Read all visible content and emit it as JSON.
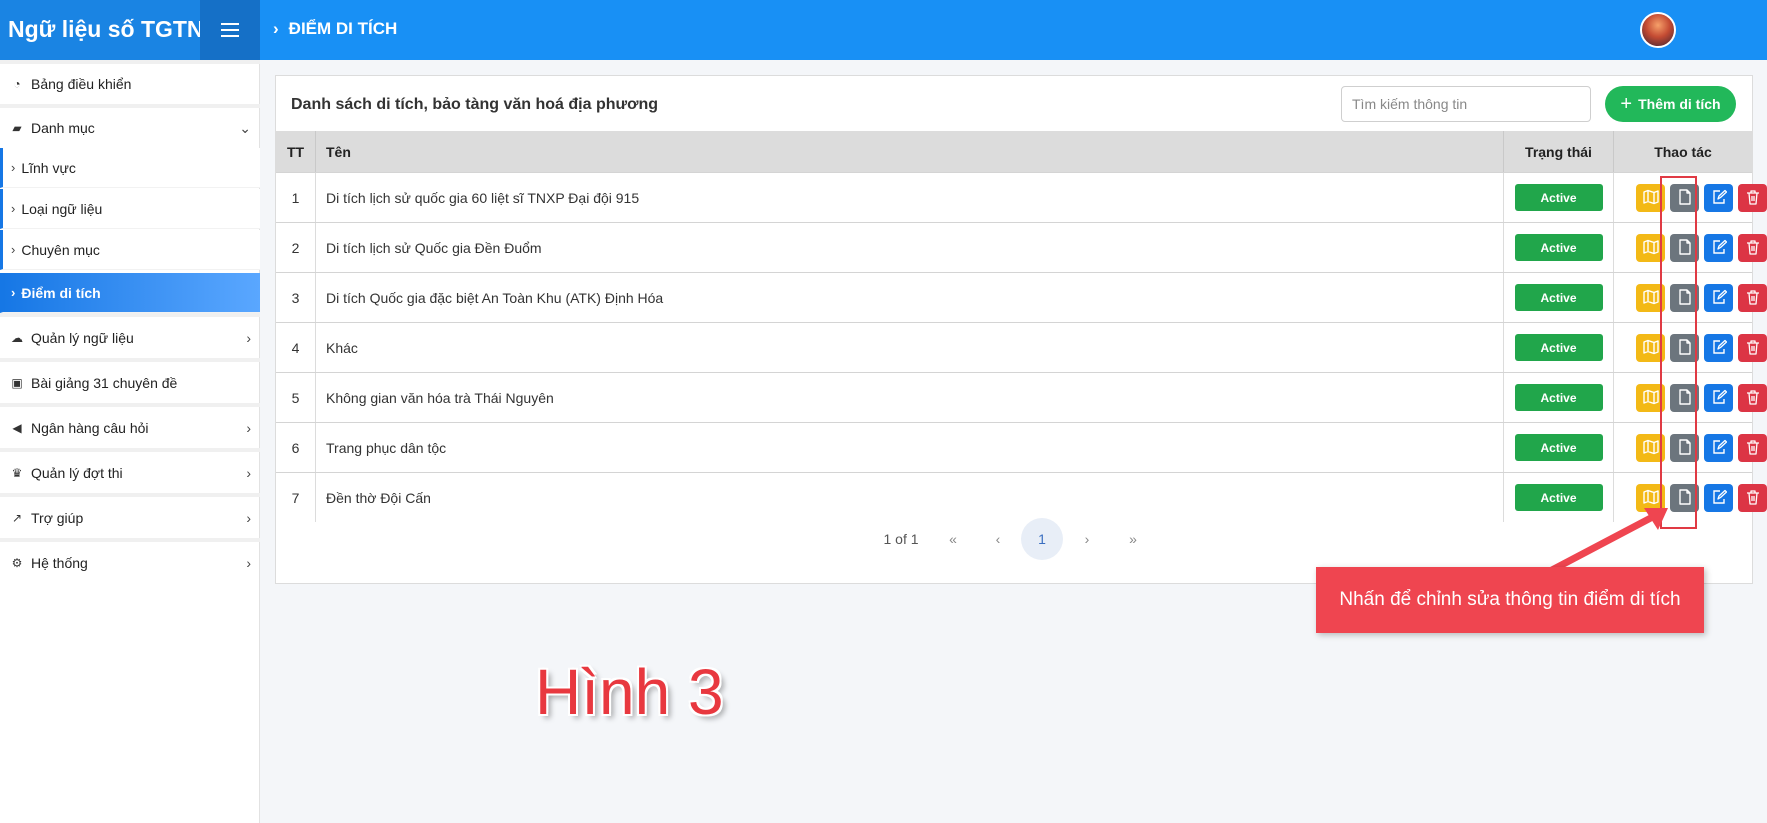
{
  "app": {
    "title": "Ngữ liệu số TGTN"
  },
  "header": {
    "breadcrumb": "ĐIỂM DI TÍCH"
  },
  "sidebar": {
    "items": [
      {
        "label": "Bảng điều khiển",
        "icon": "dashboard-icon"
      },
      {
        "label": "Danh mục",
        "icon": "folder-open-icon"
      },
      {
        "label": "Lĩnh vực"
      },
      {
        "label": "Loại ngữ liệu"
      },
      {
        "label": "Chuyên mục"
      },
      {
        "label": "Điểm di tích"
      },
      {
        "label": "Quản lý ngữ liệu",
        "icon": "cloud-icon"
      },
      {
        "label": "Bài giảng 31 chuyên đề",
        "icon": "archive-icon"
      },
      {
        "label": "Ngân hàng câu hỏi",
        "icon": "megaphone-icon"
      },
      {
        "label": "Quản lý đợt thi",
        "icon": "trophy-icon"
      },
      {
        "label": "Trợ giúp",
        "icon": "chart-line-icon"
      },
      {
        "label": "Hệ thống",
        "icon": "gears-icon"
      }
    ]
  },
  "main": {
    "title": "Danh sách di tích, bảo tàng văn hoá địa phương",
    "search_placeholder": "Tìm kiếm thông tin",
    "add_label": "Thêm di tích",
    "columns": [
      "TT",
      "Tên",
      "Trạng thái",
      "Thao tác"
    ],
    "rows": [
      {
        "tt": "1",
        "name": "Di tích lịch sử quốc gia 60 liệt sĩ TNXP Đại đội 915",
        "status": "Active"
      },
      {
        "tt": "2",
        "name": "Di tích lịch sử Quốc gia Đền Đuổm",
        "status": "Active"
      },
      {
        "tt": "3",
        "name": "Di tích Quốc gia đặc biệt An Toàn Khu (ATK) Định Hóa",
        "status": "Active"
      },
      {
        "tt": "4",
        "name": "Khác",
        "status": "Active"
      },
      {
        "tt": "5",
        "name": "Không gian văn hóa trà Thái Nguyên",
        "status": "Active"
      },
      {
        "tt": "6",
        "name": "Trang phục dân tộc",
        "status": "Active"
      },
      {
        "tt": "7",
        "name": "Đền thờ Đội Cấn",
        "status": "Active"
      }
    ],
    "pagination": {
      "summary": "1 of 1",
      "first": "«",
      "prev": "‹",
      "current": "1",
      "next": "›",
      "last": "»"
    }
  },
  "annotations": {
    "callout": "Nhấn để chỉnh sửa thông tin điểm di tích",
    "figure_label": "Hình 3"
  },
  "colors": {
    "topbar": "#1890f5",
    "active_badge": "#21a64b",
    "add_button": "#22b85a",
    "map_button": "#f3b916",
    "doc_button": "#6c757d",
    "edit_button": "#1677e5",
    "delete_button": "#dc3545",
    "callout": "#ef4550"
  }
}
